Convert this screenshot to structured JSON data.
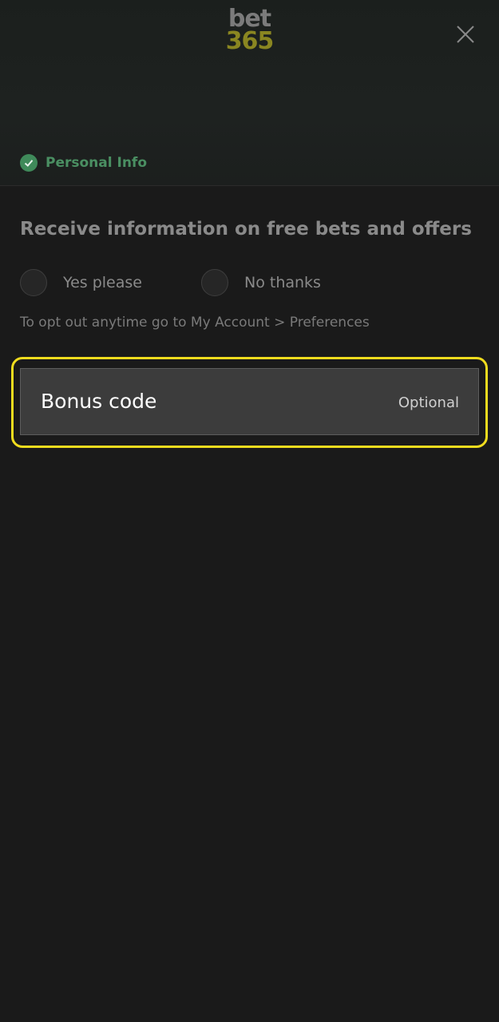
{
  "header": {
    "logo_top": "bet",
    "logo_bottom": "365",
    "close_icon": "close-icon"
  },
  "progress": {
    "step_label": "Personal Info",
    "step_status": "completed",
    "step_icon": "check-circle-icon"
  },
  "marketing": {
    "title": "Receive information on free bets and offers",
    "options": [
      {
        "label": "Yes please",
        "selected": false
      },
      {
        "label": "No thanks",
        "selected": false
      }
    ],
    "hint": "To opt out anytime go to My Account > Preferences"
  },
  "bonus": {
    "label": "Bonus code",
    "optional_text": "Optional",
    "value": ""
  },
  "colors": {
    "brand_yellow": "#8a8621",
    "success_green": "#3f8a5a",
    "highlight_yellow": "#f0dc1e",
    "background": "#1a1a1a"
  }
}
